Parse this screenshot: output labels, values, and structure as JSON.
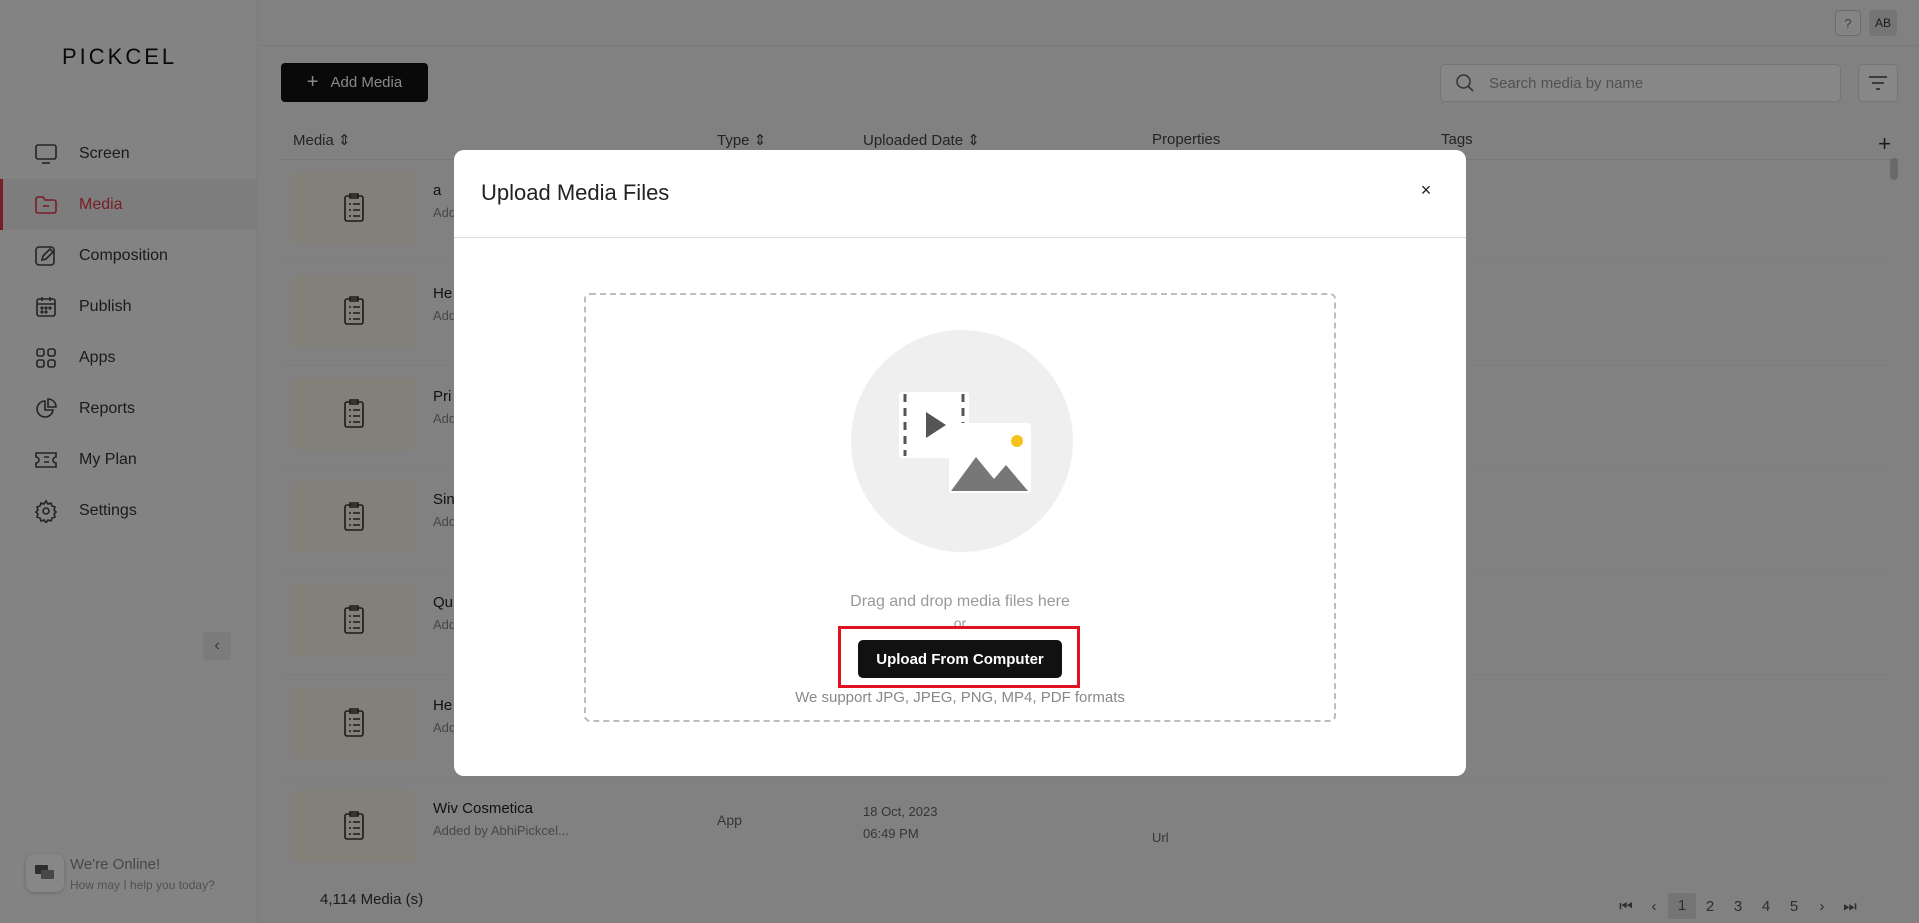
{
  "brand": {
    "logo": "PICKCEL",
    "accent": "#e2394a"
  },
  "topbar": {
    "help": "?",
    "avatar": "AB"
  },
  "sidebar": {
    "items": [
      {
        "label": "Screen",
        "icon": "monitor-icon"
      },
      {
        "label": "Media",
        "icon": "folder-icon",
        "active": true
      },
      {
        "label": "Composition",
        "icon": "edit-icon"
      },
      {
        "label": "Publish",
        "icon": "calendar-icon"
      },
      {
        "label": "Apps",
        "icon": "grid-icon"
      },
      {
        "label": "Reports",
        "icon": "pie-chart-icon"
      },
      {
        "label": "My Plan",
        "icon": "ticket-icon"
      },
      {
        "label": "Settings",
        "icon": "gear-icon"
      }
    ],
    "collapse": "‹",
    "chat": {
      "line1": "We're Online!",
      "line2": "How may I help you today?"
    }
  },
  "toolbar": {
    "add_media_label": "Add Media",
    "search_placeholder": "Search media by name"
  },
  "table": {
    "headers": {
      "media": "Media",
      "type": "Type",
      "uploaded": "Uploaded Date",
      "properties": "Properties",
      "tags": "Tags"
    },
    "rows": [
      {
        "name": "a",
        "by": "Add"
      },
      {
        "name": "He",
        "by": "Add"
      },
      {
        "name": "Pri",
        "by": "Add"
      },
      {
        "name": "Sin",
        "by": "Add"
      },
      {
        "name": "Qu",
        "by": "Add"
      },
      {
        "name": "He",
        "by": "Add"
      },
      {
        "name": "Wiv Cosmetica",
        "by": "Added by AbhiPickcel...",
        "type": "App",
        "date1": "18 Oct, 2023",
        "date2": "06:49 PM",
        "prop": "Url"
      }
    ]
  },
  "footer": {
    "count": "4,114 Media (s)",
    "pages": [
      "1",
      "2",
      "3",
      "4",
      "5"
    ],
    "current_page": "1"
  },
  "modal": {
    "title": "Upload Media Files",
    "close": "×",
    "drag_text": "Drag and drop media files here",
    "or_text": "or",
    "upload_button": "Upload From Computer",
    "formats": "We support JPG, JPEG, PNG, MP4, PDF formats"
  }
}
